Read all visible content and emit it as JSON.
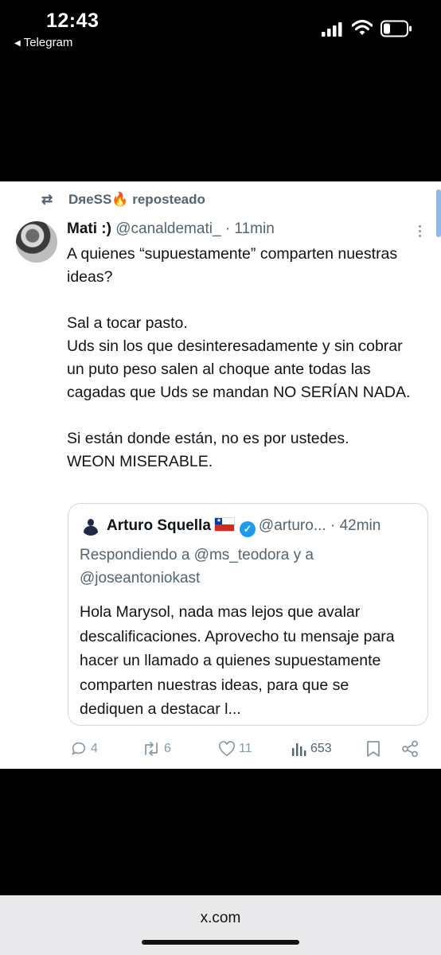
{
  "status_bar": {
    "time": "12:43",
    "back_app": "Telegram"
  },
  "repost": {
    "user": "DяeSS🔥",
    "label": "reposteado"
  },
  "tweet": {
    "name": "Mati :)",
    "handle": "@canaldemati_",
    "time": "11min",
    "lines": [
      "A quienes “supuestamente” comparten nuestras ideas?",
      "",
      "Sal a tocar pasto.",
      "Uds sin los que desinteresadamente y sin cobrar un puto peso salen al choque ante todas las cagadas que Uds se mandan NO SERÍAN NADA.",
      "",
      "Si están donde están, no es por ustedes.",
      "WEON MISERABLE."
    ]
  },
  "quote": {
    "name": "Arturo Squella",
    "handle": "@arturo...",
    "time": "42min",
    "replying_to": "Respondiendo a @ms_teodora y a @joseantoniokast",
    "text": "Hola Marysol,  nada mas lejos que avalar descalificaciones. Aprovecho tu mensaje para hacer un llamado a quienes supuestamente comparten nuestras ideas,  para que se dediquen a destacar l..."
  },
  "actions": {
    "replies": "4",
    "reposts": "6",
    "likes": "11",
    "views": "653"
  },
  "browser": {
    "url": "x.com"
  },
  "colors": {
    "accent": "#1d9bf0",
    "muted": "#536471",
    "flag_red": "#d52b1e",
    "flag_blue": "#0039a6"
  }
}
